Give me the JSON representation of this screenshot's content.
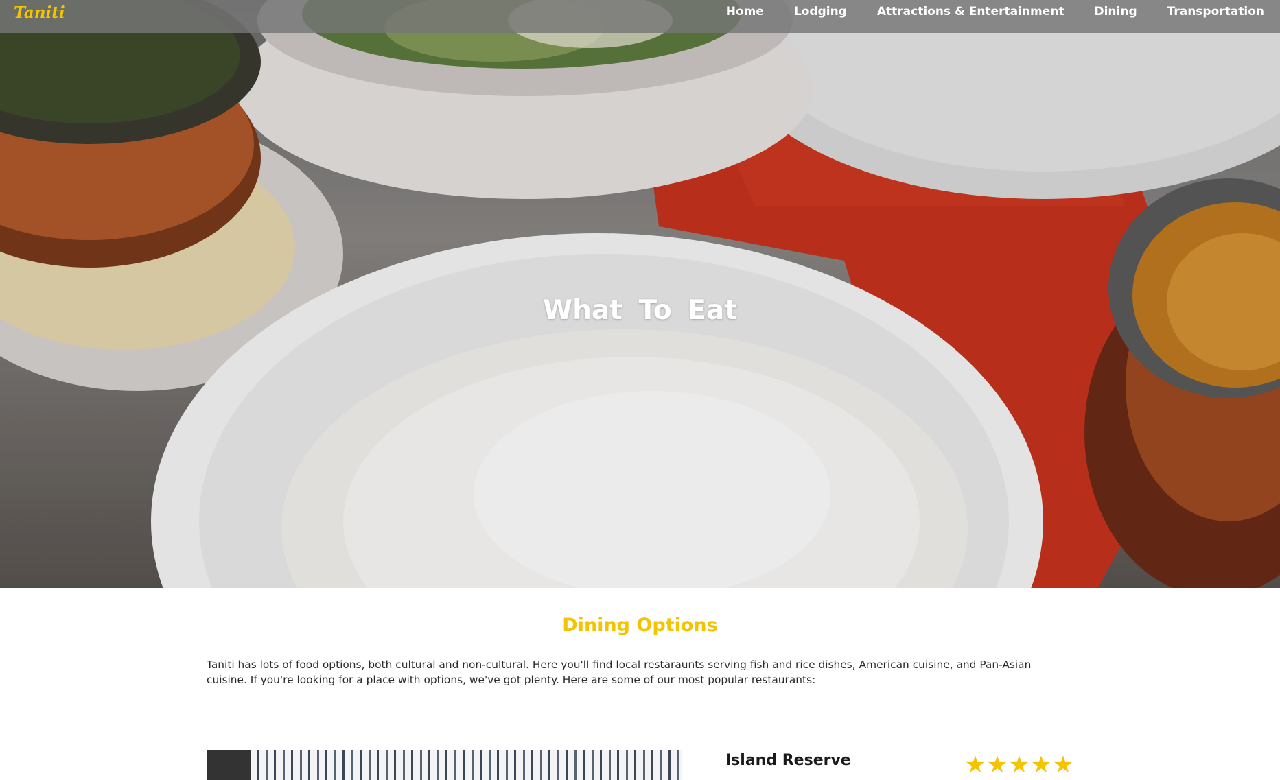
{
  "brand": {
    "name": "Taniti"
  },
  "nav": {
    "items": [
      {
        "label": "Home"
      },
      {
        "label": "Lodging"
      },
      {
        "label": "Attractions & Entertainment"
      },
      {
        "label": "Dining"
      },
      {
        "label": "Transportation"
      }
    ]
  },
  "hero": {
    "title": "What To Eat"
  },
  "dining": {
    "heading": "Dining Options",
    "intro": "Taniti has lots of food options, both cultural and non-cultural. Here you'll find local restaraunts serving fish and rice dishes, American cuisine, and Pan-Asian cuisine. If you're looking for a place with options, we've got plenty. Here are some of our most popular restaurants:",
    "restaurants": [
      {
        "name": "Island Reserve",
        "rating": 5,
        "rating_max": 5
      }
    ]
  },
  "colors": {
    "accent": "#f5c400",
    "navbar": "#767676",
    "text": "#2b2b2b"
  },
  "icons": {
    "star": "star-icon"
  }
}
